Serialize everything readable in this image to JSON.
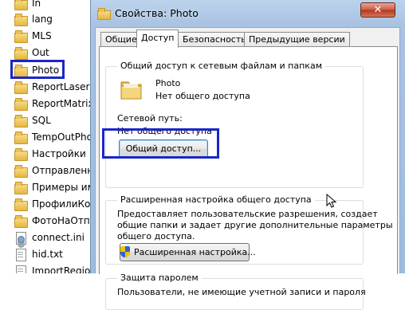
{
  "explorer": {
    "items": [
      {
        "label": "In",
        "type": "folder"
      },
      {
        "label": "lang",
        "type": "folder"
      },
      {
        "label": "MLS",
        "type": "folder"
      },
      {
        "label": "Out",
        "type": "folder"
      },
      {
        "label": "Photo",
        "type": "folder"
      },
      {
        "label": "ReportLaserPr",
        "type": "folder"
      },
      {
        "label": "ReportMatrixP",
        "type": "folder"
      },
      {
        "label": "SQL",
        "type": "folder"
      },
      {
        "label": "TempOutPhot",
        "type": "folder"
      },
      {
        "label": "Настройки",
        "type": "folder"
      },
      {
        "label": "Отправленны",
        "type": "folder"
      },
      {
        "label": "Примеры имг",
        "type": "folder"
      },
      {
        "label": "ПрофилиКон",
        "type": "folder"
      },
      {
        "label": "ФотоНаОтпра",
        "type": "folder"
      },
      {
        "label": "connect.ini",
        "type": "ini-file"
      },
      {
        "label": "hid.txt",
        "type": "text-file"
      },
      {
        "label": "ImportRegions",
        "type": "text-file"
      }
    ]
  },
  "dialog": {
    "title": "Свойства: Photo",
    "close_glyph": "✕",
    "tabs": [
      "Общие",
      "Доступ",
      "Безопасность",
      "Предыдущие версии"
    ],
    "active_tab": "Доступ",
    "network_sharing": {
      "title": "Общий доступ к сетевым файлам и папкам",
      "folder_name": "Photo",
      "folder_status": "Нет общего доступа",
      "path_label": "Сетевой путь:",
      "path_value": "Нет общего доступа",
      "share_button": "Общий доступ..."
    },
    "advanced_sharing": {
      "title": "Расширенная настройка общего доступа",
      "description_lines": [
        "Предоставляет пользовательские разрешения, создает",
        "общие папки и задает другие дополнительные параметры",
        "общего доступа."
      ],
      "button": "Расширенная настройка..."
    },
    "password": {
      "title": "Защита паролем",
      "text": "Пользователи, не имеющие учетной записи и пароля"
    }
  }
}
